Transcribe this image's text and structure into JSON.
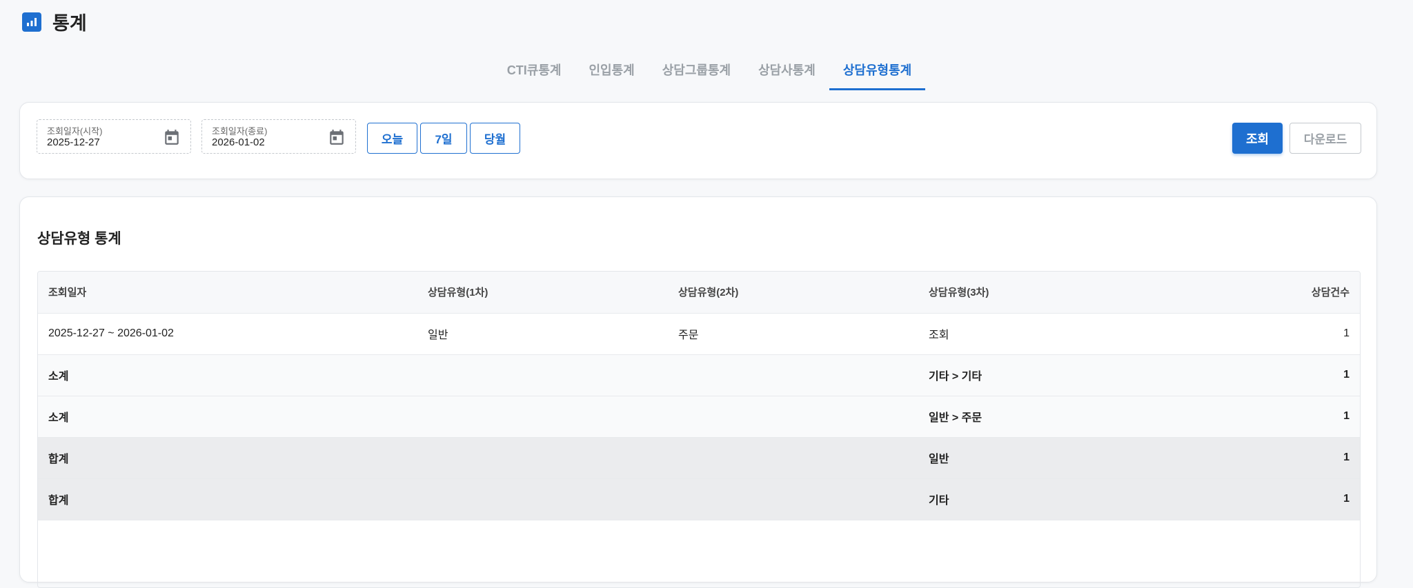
{
  "header": {
    "title": "통계",
    "icon": "bar-chart-icon"
  },
  "tabs": [
    {
      "label": "CTI큐통계",
      "active": false
    },
    {
      "label": "인입통계",
      "active": false
    },
    {
      "label": "상담그룹통계",
      "active": false
    },
    {
      "label": "상담사통계",
      "active": false
    },
    {
      "label": "상담유형통계",
      "active": true
    }
  ],
  "filter": {
    "start_label": "조회일자(시작)",
    "start_value": "2025-12-27",
    "end_label": "조회일자(종료)",
    "end_value": "2026-01-02",
    "calendar_icon": "calendar-icon",
    "quick": {
      "today": "오늘",
      "week": "7일",
      "month": "당월"
    },
    "search_label": "조회",
    "download_label": "다운로드"
  },
  "result": {
    "title": "상담유형 통계",
    "columns": [
      "조회일자",
      "상담유형(1차)",
      "상담유형(2차)",
      "상담유형(3차)",
      "상담건수"
    ],
    "rows": [
      {
        "type": "data",
        "cells": [
          "2025-12-27 ~ 2026-01-02",
          "일반",
          "주문",
          "조회",
          "1"
        ]
      },
      {
        "type": "subtotal",
        "cells": [
          "소계",
          "",
          "",
          "기타 > 기타",
          "1"
        ]
      },
      {
        "type": "subtotal",
        "cells": [
          "소계",
          "",
          "",
          "일반 > 주문",
          "1"
        ]
      },
      {
        "type": "total",
        "cells": [
          "합계",
          "",
          "",
          "일반",
          "1"
        ]
      },
      {
        "type": "total",
        "cells": [
          "합계",
          "",
          "",
          "기타",
          "1"
        ]
      }
    ]
  },
  "colors": {
    "accent": "#1e6fd0",
    "muted": "#9aa0a6",
    "total_row": "#ebecee"
  }
}
